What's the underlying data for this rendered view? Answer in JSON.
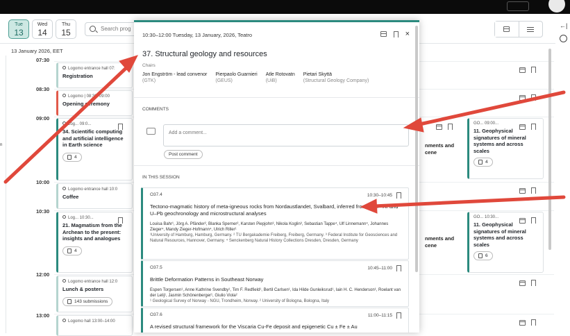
{
  "days": [
    {
      "dow": "Tue",
      "num": "13",
      "active": true
    },
    {
      "dow": "Wed",
      "num": "14",
      "active": false
    },
    {
      "dow": "Thu",
      "num": "15",
      "active": false
    }
  ],
  "search_placeholder": "Search prog",
  "date_label": "13 January 2026, EET",
  "times": [
    "07:30",
    "08:30",
    "09:00",
    "10:00",
    "10:30",
    "12:00",
    "13:00"
  ],
  "stray_text": "n",
  "cards": [
    {
      "loc": "Logomo entrance hall 07:",
      "title": "Registration"
    },
    {
      "loc": "Logomo | 08:30–09:00",
      "title": "Opening ceremony"
    },
    {
      "loc": "Log... 09:0...",
      "title": "34. Scientific computing and artificial intelligence in Earth science",
      "count": "4"
    },
    {
      "loc": "Logomo entrance hall 10:0",
      "title": "Coffee"
    },
    {
      "loc": "Log... 10:30...",
      "title": "21. Magmatism from the Archean to the present: insights and analogues",
      "count": "4"
    },
    {
      "loc": "Logomo entrance hall 12:0",
      "title": "Lunch & posters",
      "count": "143 submissions"
    },
    {
      "loc": "Logomo hall 13:00–14:00",
      "title": ""
    }
  ],
  "right_cards": [
    {
      "loc": "GO... 09:00...",
      "title": "11. Geophysical signatures of mineral systems and across scales",
      "count": "4"
    },
    {
      "loc": "GO... 10:30...",
      "title": "11. Geophysical signatures of mineral systems and across scales",
      "count": "6"
    }
  ],
  "mid_text": [
    "nments and",
    "cene"
  ],
  "modal": {
    "header": "10:30–12:00 Tuesday, 13 January, 2026, Teatro",
    "close": "×",
    "title": "37. Structural geology and resources",
    "chairs_label": "Chairs",
    "chairs": [
      {
        "name": "Jon Engström - lead convenor",
        "org": "(GTK)"
      },
      {
        "name": "Pierpaolo Guarnieri",
        "org": "(GEUS)"
      },
      {
        "name": "Atle Rotovatn",
        "org": "(UiB)"
      },
      {
        "name": "Pietari Skyttä",
        "org": "(Structural Geology Company)"
      }
    ],
    "comments_label": "COMMENTS",
    "comment_placeholder": "Add a comment...",
    "post_button": "Post comment",
    "in_session_label": "IN THIS SESSION",
    "abstracts": [
      {
        "code": "O37.4",
        "time": "10:30–10:45",
        "title": "Tectono-magmatic history of meta-igneous rocks from Nordaustlandet, Svalbard, inferred from ⁴⁰Ar/³⁹Ar and U–Pb geochronology and microstructural analyses",
        "authors": "Louisa Bahr¹, Jörg A. Pfänder², Blanka Sperner², Karsten Piepjohn³, Nikola Koglin³, Sebastian Tappe⁴, Ulf Linnemann⁴, Johannes Zieger⁴, Mandy Zieger-Hofmann⁴, Ulrich Riller¹",
        "affil": "¹University of Hamburg, Hamburg, Germany. ² TU Bergakademie Freiberg, Freiberg, Germany. ³ Federal Institute for Geosciences and Natural Resources, Hannover, Germany. ⁴ Senckenberg Natural History Collections Dresden, Dresden, Germany"
      },
      {
        "code": "O37.5",
        "time": "10:45–11:00",
        "title": "Brittle Deformation Patterns in Southeast Norway",
        "authors": "Espen Torgersen¹, Anne Kathrine Svendby¹, Tim F. Redfield¹, Bertil Carlsen¹, Ida Hilde Gunleiksrud¹, Iain H. C. Henderson¹, Roelant van der Lelij¹, Jasmin Schönenberger¹, Giulio Viola²",
        "affil": "¹ Geological Survey of Norway - NGU, Trondheim, Norway. ² University of Bologna, Bologna, Italy"
      },
      {
        "code": "O37.6",
        "time": "11:00–11:15",
        "title": "A revised structural framework for the Viscaria Cu-Fe deposit and epigenetic Cu ± Fe ± Au",
        "authors": "",
        "affil": ""
      }
    ]
  },
  "colors": {
    "accent": "#2b8a7e",
    "arrow": "#e0483b"
  }
}
